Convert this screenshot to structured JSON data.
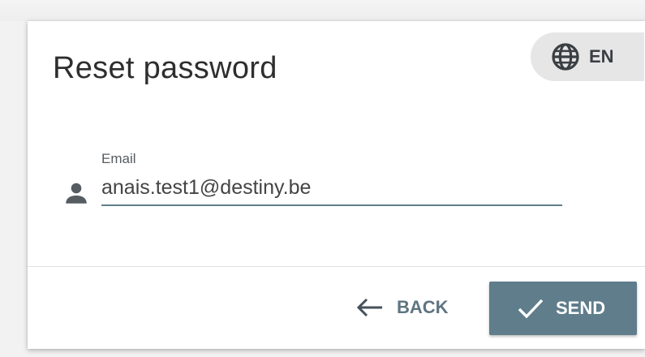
{
  "dialog": {
    "title": "Reset password"
  },
  "language": {
    "label": "EN",
    "icon": "globe-icon"
  },
  "email_field": {
    "label": "Email",
    "value": "anais.test1@destiny.be",
    "icon": "person-icon"
  },
  "actions": {
    "back_label": "BACK",
    "back_icon": "arrow-left-icon",
    "send_label": "SEND",
    "send_icon": "check-icon"
  },
  "colors": {
    "accent": "#5f7d8b",
    "background": "#ffffff",
    "chip": "#e6e6e6"
  }
}
